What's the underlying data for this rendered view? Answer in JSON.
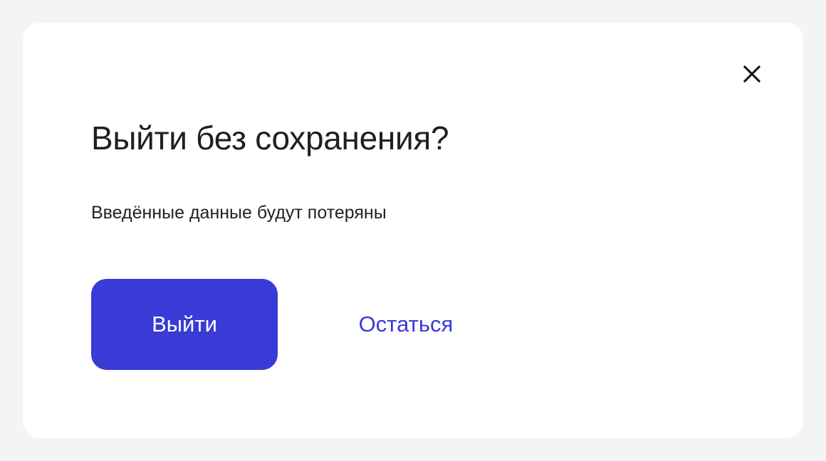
{
  "dialog": {
    "title": "Выйти без сохранения?",
    "message": "Введённые данные будут потеряны",
    "close_icon": "close-icon",
    "primary_button_label": "Выйти",
    "secondary_button_label": "Остаться"
  },
  "colors": {
    "page_background": "#f4f4f4",
    "dialog_background": "#ffffff",
    "accent": "#3a3ad6",
    "title_text": "#1f1f1f",
    "body_text": "#222222"
  }
}
